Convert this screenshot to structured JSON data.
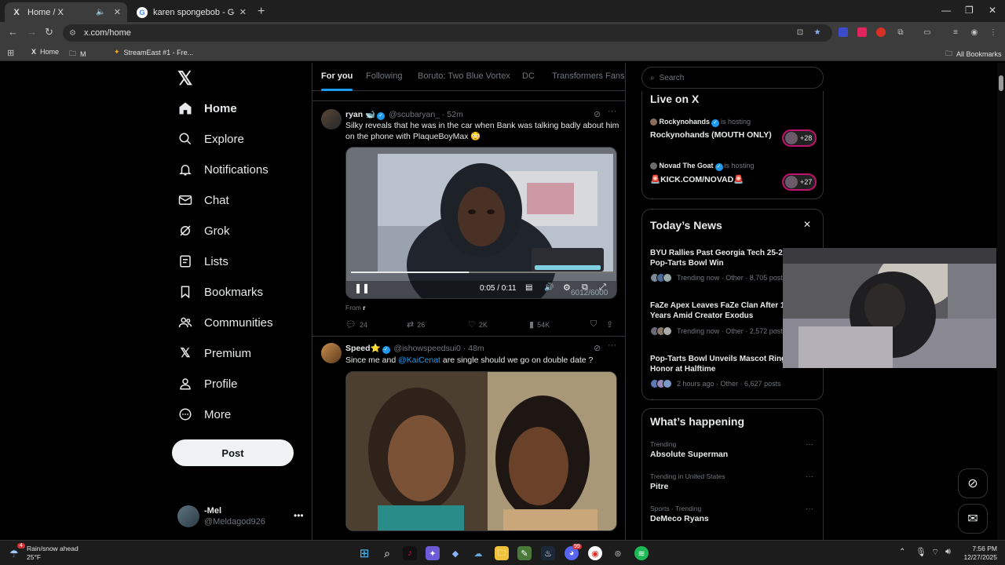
{
  "browser": {
    "tabs": [
      {
        "title": "Home / X",
        "favicon": "X"
      },
      {
        "title": "karen spongebob - Google Sea",
        "favicon": "G"
      }
    ],
    "url": "x.com/home",
    "bookmarks": [
      {
        "label": "Home"
      },
      {
        "label": "M"
      },
      {
        "label": "StreamEast #1 - Fre..."
      }
    ],
    "all_bookmarks": "All Bookmarks"
  },
  "leftnav": {
    "items": [
      {
        "label": "Home",
        "icon": "house-icon"
      },
      {
        "label": "Explore",
        "icon": "search-icon"
      },
      {
        "label": "Notifications",
        "icon": "bell-icon"
      },
      {
        "label": "Chat",
        "icon": "envelope-icon"
      },
      {
        "label": "Grok",
        "icon": "grok-icon"
      },
      {
        "label": "Lists",
        "icon": "list-icon"
      },
      {
        "label": "Bookmarks",
        "icon": "bookmark-icon"
      },
      {
        "label": "Communities",
        "icon": "people-icon"
      },
      {
        "label": "Premium",
        "icon": "x-icon"
      },
      {
        "label": "Profile",
        "icon": "person-icon"
      },
      {
        "label": "More",
        "icon": "more-circle-icon"
      }
    ],
    "post_label": "Post",
    "account": {
      "name": "-Mel",
      "handle": "@Meldagod926"
    }
  },
  "feed": {
    "tabs": [
      "For you",
      "Following",
      "Boruto: Two Blue Vortex",
      "DC",
      "Transformers Fans"
    ],
    "tweets": [
      {
        "name": "ryan 🐋",
        "handle": "@scubaryan_",
        "time": "52m",
        "text": "Silky reveals that he was in the car when Bank was talking badly about him on the phone with PlaqueBoyMax 😳",
        "video": {
          "time": "0:05 / 0:11",
          "progress": 0.45,
          "overlay": "6012/6000"
        },
        "from_prefix": "From ",
        "from": "r",
        "stats": {
          "replies": "24",
          "reposts": "26",
          "likes": "2K",
          "views": "54K"
        }
      },
      {
        "name": "Speed⭐",
        "handle": "@ishowspeedsui0",
        "time": "48m",
        "text_before": "Since me and ",
        "mention": "@KaiCenat",
        "text_after": " are single should we go on double date ?"
      }
    ]
  },
  "right": {
    "search_placeholder": "Search",
    "live": {
      "title": "Live on X",
      "hosts": [
        {
          "host": "Rockynohands",
          "status": "is hosting",
          "title": "Rockynohands  (MOUTH ONLY)",
          "count": "+28"
        },
        {
          "host": "Novad The Goat",
          "status": "is hosting",
          "title": "🚨KICK.COM/NOVAD🚨",
          "count": "+27"
        }
      ]
    },
    "news": {
      "title": "Today’s News",
      "items": [
        {
          "title": "BYU Rallies Past Georgia Tech 25-21 in Pop-Tarts Bowl Win",
          "meta": "Trending now · Other · 8,705 posts"
        },
        {
          "title": "FaZe Apex Leaves FaZe Clan After 15 Years Amid Creator Exodus",
          "meta": "Trending now · Other · 2,572 posts"
        },
        {
          "title": "Pop-Tarts Bowl Unveils Mascot Ring Honor at Halftime",
          "meta": "2 hours ago · Other · 6,627 posts"
        }
      ]
    },
    "happening": {
      "title": "What’s happening",
      "trends": [
        {
          "meta": "Trending",
          "name": "Absolute Superman"
        },
        {
          "meta": "Trending in United States",
          "name": "Pitre"
        },
        {
          "meta": "Sports · Trending",
          "name": "DeMeco Ryans"
        }
      ]
    }
  },
  "taskbar": {
    "weather_line1": "Rain/snow ahead",
    "weather_line2": "25°F",
    "weather_badge": "4",
    "time": "7:56 PM",
    "date": "12/27/2025",
    "discord_badge": "99"
  },
  "colors": {
    "accent": "#1d9bf0",
    "live_ring": "#c0126c",
    "background": "#000000"
  }
}
